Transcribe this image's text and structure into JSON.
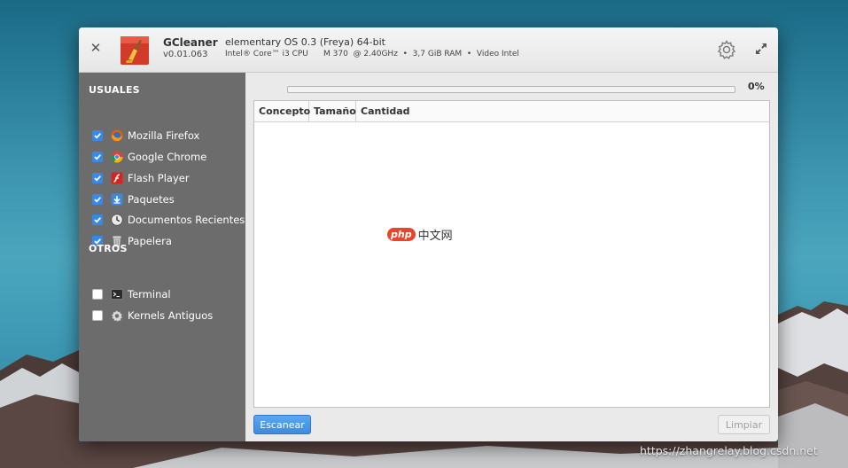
{
  "window": {
    "app_name": "GCleaner",
    "app_version": "v0.01.063",
    "system_title": "elementary OS 0.3 (Freya) 64-bit",
    "system_info": "Intel® Core™ i3 CPU      M 370  @ 2.40GHz  •  3,7 GiB RAM  •  Video Intel",
    "close_icon": "close-icon",
    "settings_icon": "gear-icon",
    "maximize_icon": "maximize-icon"
  },
  "sidebar": {
    "sections": [
      {
        "title": "USUALES",
        "items": [
          {
            "label": "Mozilla Firefox",
            "checked": true,
            "icon": "firefox-icon"
          },
          {
            "label": "Google Chrome",
            "checked": true,
            "icon": "chrome-icon"
          },
          {
            "label": "Flash Player",
            "checked": true,
            "icon": "flash-icon"
          },
          {
            "label": "Paquetes",
            "checked": true,
            "icon": "package-icon"
          },
          {
            "label": "Documentos Recientes",
            "checked": true,
            "icon": "recent-documents-icon"
          },
          {
            "label": "Papelera",
            "checked": true,
            "icon": "trash-icon"
          }
        ]
      },
      {
        "title": "OTROS",
        "items": [
          {
            "label": "Terminal",
            "checked": false,
            "icon": "terminal-icon"
          },
          {
            "label": "Kernels Antiguos",
            "checked": false,
            "icon": "kernel-gear-icon"
          }
        ]
      }
    ]
  },
  "main": {
    "progress": {
      "value": 0,
      "label": "0%"
    },
    "table": {
      "columns": [
        "Concepto",
        "Tamaño",
        "Cantidad"
      ],
      "rows": []
    },
    "watermark": {
      "badge": "php",
      "text": "中文网"
    },
    "scan_button": "Escanear",
    "clean_button": "Limpiar",
    "clean_enabled": false
  },
  "desktop": {
    "watermark_url": "https://zhangrelay.blog.csdn.net"
  },
  "colors": {
    "accent": "#3689e6",
    "sidebar_bg": "#6c6c6c",
    "desktop_sky": "#3b93ad"
  }
}
